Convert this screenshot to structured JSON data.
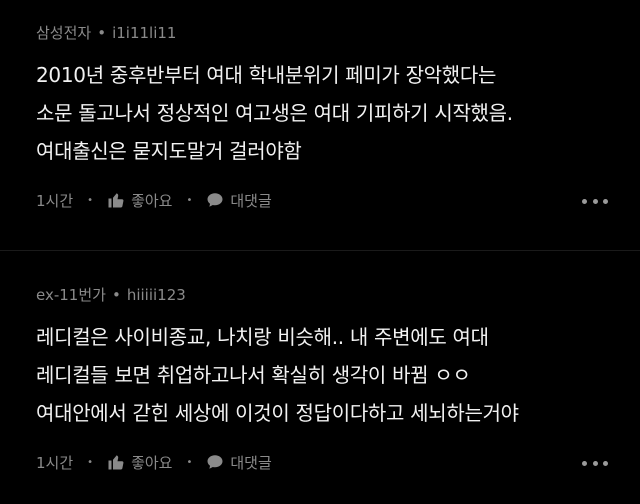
{
  "comments": [
    {
      "source": "삼성전자",
      "separator": "•",
      "author": "i1i11li11",
      "lines": [
        "2010년 중후반부터 여대 학내분위기 페미가 장악했다는",
        "소문 돌고나서 정상적인 여고생은 여대 기피하기 시작했음.",
        "여대출신은 묻지도말거 걸러야함"
      ],
      "time": "1시간",
      "like_label": "좋아요",
      "reply_label": "대댓글"
    },
    {
      "source": "ex-11번가",
      "separator": "•",
      "author": "hiiiii123",
      "lines": [
        "레디컬은 사이비종교, 나치랑 비슷해.. 내 주변에도 여대",
        "레디컬들 보면 취업하고나서 확실히 생각이 바뀜 ㅇㅇ",
        "여대안에서 갇힌 세상에 이것이 정답이다하고 세뇌하는거야"
      ],
      "time": "1시간",
      "like_label": "좋아요",
      "reply_label": "대댓글"
    }
  ],
  "action_separator": "•",
  "colors": {
    "background": "#000000",
    "text": "#f2f2f2",
    "muted": "#8a8a8a"
  },
  "icons": {
    "like": "thumbs-up-icon",
    "reply": "speech-bubble-icon",
    "more": "more-dots-icon"
  }
}
